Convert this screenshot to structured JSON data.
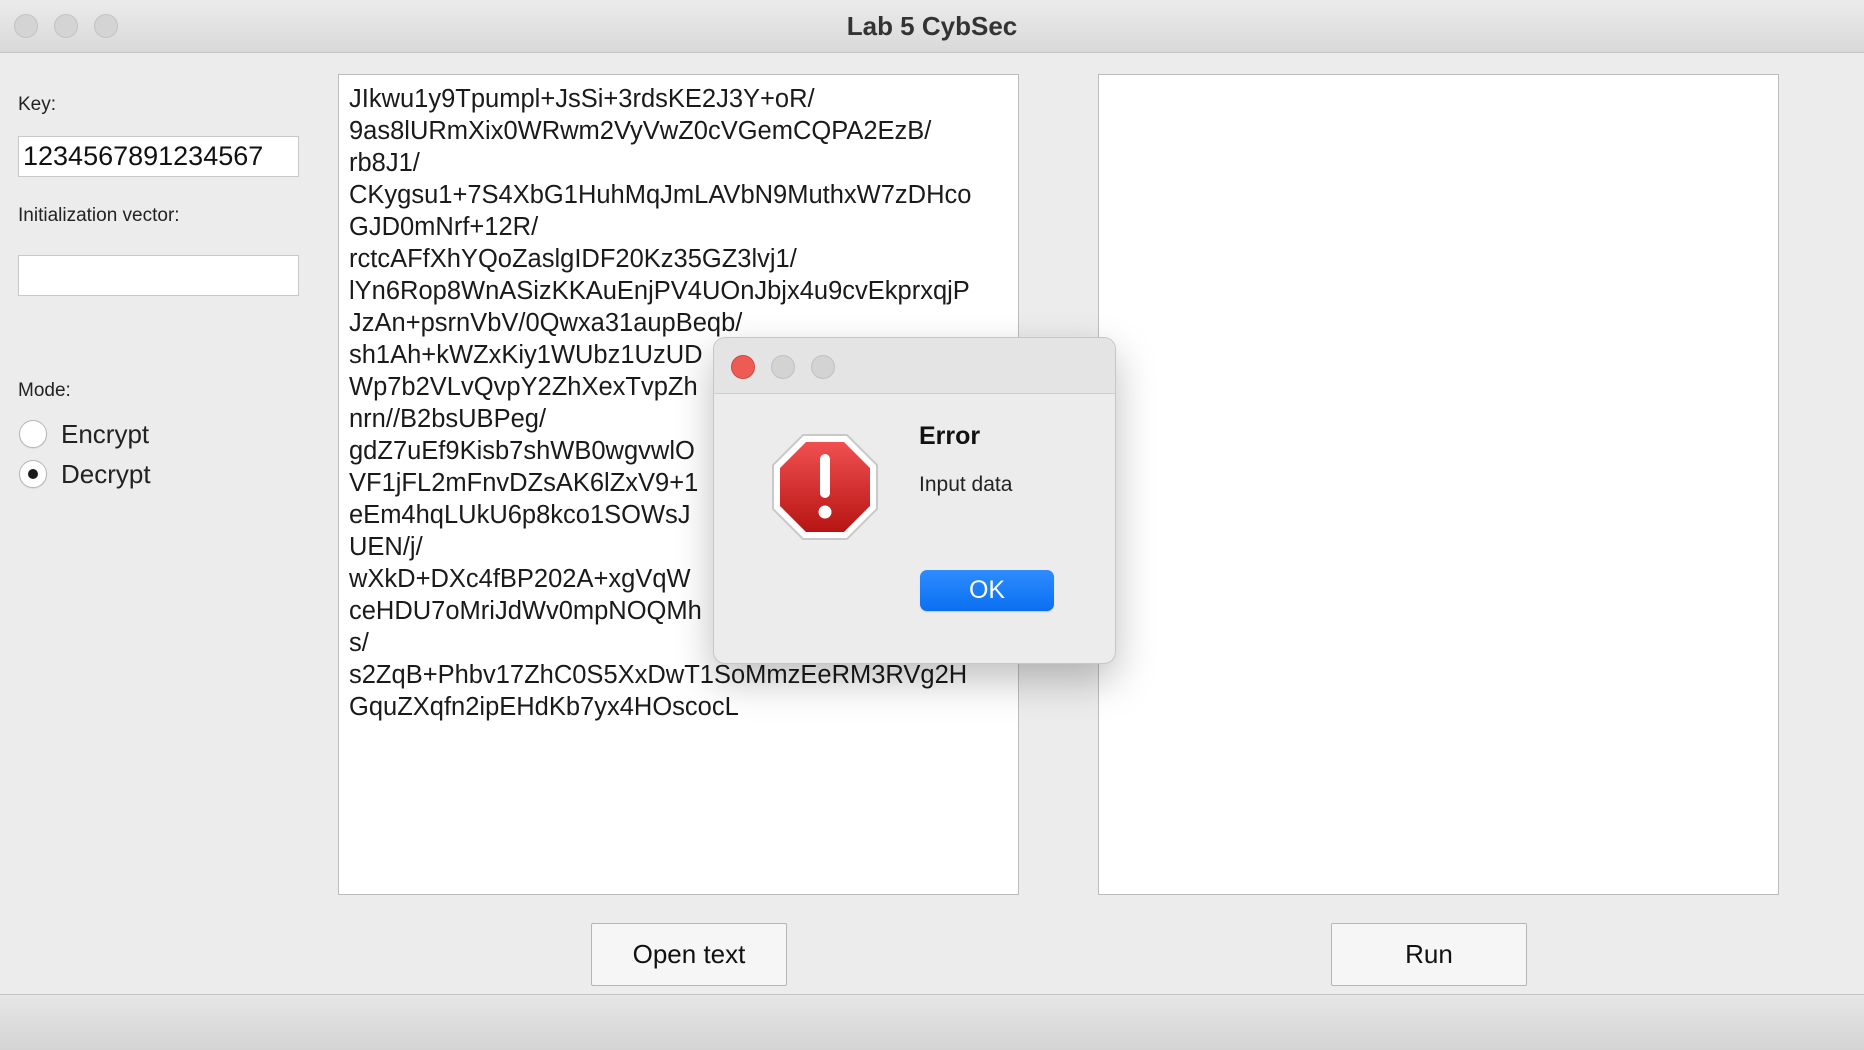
{
  "window": {
    "title": "Lab 5 CybSec"
  },
  "form": {
    "key_label": "Key:",
    "key_value": "1234567891234567",
    "iv_label": "Initialization vector:",
    "iv_value": "",
    "mode_label": "Mode:",
    "mode_options": [
      {
        "label": "Encrypt",
        "selected": false
      },
      {
        "label": "Decrypt",
        "selected": true
      }
    ]
  },
  "input_text": {
    "lines": [
      "JIkwu1y9Tpumpl+JsSi+3rdsKE2J3Y+oR/",
      "9as8lURmXix0WRwm2VyVwZ0cVGemCQPA2EzB/",
      "rb8J1/",
      "CKygsu1+7S4XbG1HuhMqJmLAVbN9MuthxW7zDHco",
      "GJD0mNrf+12R/",
      "rctcAFfXhYQoZaslgIDF20Kz35GZ3lvj1/",
      "lYn6Rop8WnASizKKAuEnjPV4UOnJbjx4u9cvEkprxqjP",
      "JzAn+psrnVbV/0Qwxa31aupBeqb/",
      "sh1Ah+kWZxKiy1WUbz1UzUD",
      "Wp7b2VLvQvpY2ZhXexTvpZh",
      "nrn//B2bsUBPeg/",
      "gdZ7uEf9Kisb7shWB0wgvwlO",
      "VF1jFL2mFnvDZsAK6lZxV9+1",
      "eEm4hqLUkU6p8kco1SOWsJ",
      "UEN/j/",
      "wXkD+DXc4fBP202A+xgVqW",
      "ceHDU7oMriJdWv0mpNOQMh",
      "s/",
      "s2ZqB+Phbv17ZhC0S5XxDwT1SoMmzEeRM3RVg2H",
      "GquZXqfn2ipEHdKb7yx4HOscocL"
    ]
  },
  "output_text": {
    "lines": []
  },
  "buttons": {
    "open_text": "Open text",
    "run": "Run"
  },
  "alert": {
    "title": "Error",
    "message": "Input data",
    "ok_label": "OK",
    "icon": "error-stop-icon",
    "icon_color": "#d32a2a"
  }
}
